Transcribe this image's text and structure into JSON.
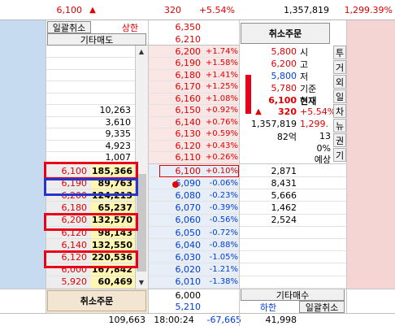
{
  "top": {
    "price": "6,100",
    "arrow": "▲",
    "change": "320",
    "pct": "+5.54%",
    "volume": "1,357,819",
    "rate": "1,299.39%"
  },
  "left_header": {
    "btn_cancel_all": "일괄취소",
    "upper_label": "상한",
    "upper_price": "6,350",
    "btn_other_sell": "기타매도",
    "other_sell_price": "6,210"
  },
  "right_panel": {
    "cancel_order_top": "취소주문",
    "labels": [
      {
        "price": "5,800",
        "name": "시"
      },
      {
        "price": "6,200",
        "name": "고"
      },
      {
        "price": "5,800",
        "name": "저"
      },
      {
        "price": "5,780",
        "name": "기준"
      },
      {
        "price": "6,100",
        "name": "현재"
      }
    ],
    "change": "320",
    "change_pct": "+5.54%",
    "volume": "1,357,819",
    "volume_rate": "1,299.",
    "vol_pct": "82억",
    "vol_num": "13",
    "zero_pct": "0%",
    "expected": "예상",
    "side_tabs": [
      "투",
      "거",
      "외",
      "일",
      "차",
      "뉴",
      "권",
      "기"
    ]
  },
  "ask_rows": [
    {
      "vol": "",
      "price": "6,200",
      "pct": "+1.74%"
    },
    {
      "vol": "",
      "price": "6,190",
      "pct": "+1.58%"
    },
    {
      "vol": "",
      "price": "6,180",
      "pct": "+1.41%"
    },
    {
      "vol": "",
      "price": "6,170",
      "pct": "+1.25%"
    },
    {
      "vol": "",
      "price": "6,160",
      "pct": "+1.08%"
    },
    {
      "vol": "10,263",
      "price": "6,150",
      "pct": "+0.92%"
    },
    {
      "vol": "3,610",
      "price": "6,140",
      "pct": "+0.76%"
    },
    {
      "vol": "9,335",
      "price": "6,130",
      "pct": "+0.59%"
    },
    {
      "vol": "4,923",
      "price": "6,120",
      "pct": "+0.43%"
    },
    {
      "vol": "1,007",
      "price": "6,110",
      "pct": "+0.26%"
    }
  ],
  "bid_rows": [
    {
      "price": "6,100",
      "pct": "+0.10%",
      "vol": "2,871",
      "lprice": "6,100",
      "lvol": "185,366"
    },
    {
      "price": "6,090",
      "pct": "-0.06%",
      "vol": "8,431",
      "lprice": "6,190",
      "lvol": "89,763"
    },
    {
      "price": "6,080",
      "pct": "-0.23%",
      "vol": "5,666",
      "lprice": "6,200",
      "lvol": "124,213"
    },
    {
      "price": "6,070",
      "pct": "-0.39%",
      "vol": "1,462",
      "lprice": "6,180",
      "lvol": "65,237"
    },
    {
      "price": "6,060",
      "pct": "-0.56%",
      "vol": "2,524",
      "lprice": "6,200",
      "lvol": "132,570"
    },
    {
      "price": "6,050",
      "pct": "-0.72%",
      "vol": "",
      "lprice": "6,120",
      "lvol": "98,143"
    },
    {
      "price": "6,040",
      "pct": "-0.88%",
      "vol": "",
      "lprice": "6,140",
      "lvol": "132,550"
    },
    {
      "price": "6,030",
      "pct": "-1.05%",
      "vol": "",
      "lprice": "6,120",
      "lvol": "220,536"
    },
    {
      "price": "6,020",
      "pct": "-1.21%",
      "vol": "",
      "lprice": "6,000",
      "lvol": "167,842"
    },
    {
      "price": "6,010",
      "pct": "-1.38%",
      "vol": "",
      "lprice": "5,920",
      "lvol": "60,469"
    }
  ],
  "bottom": {
    "price1": "6,000",
    "price2": "5,210",
    "cancel_order": "취소주문",
    "btn_other_buy": "기타매수",
    "lower_label": "하한",
    "btn_cancel_all": "일괄취소",
    "total_left": "109,663",
    "time": "18:00:24",
    "diff": "-67,665",
    "total_right": "41,998"
  }
}
